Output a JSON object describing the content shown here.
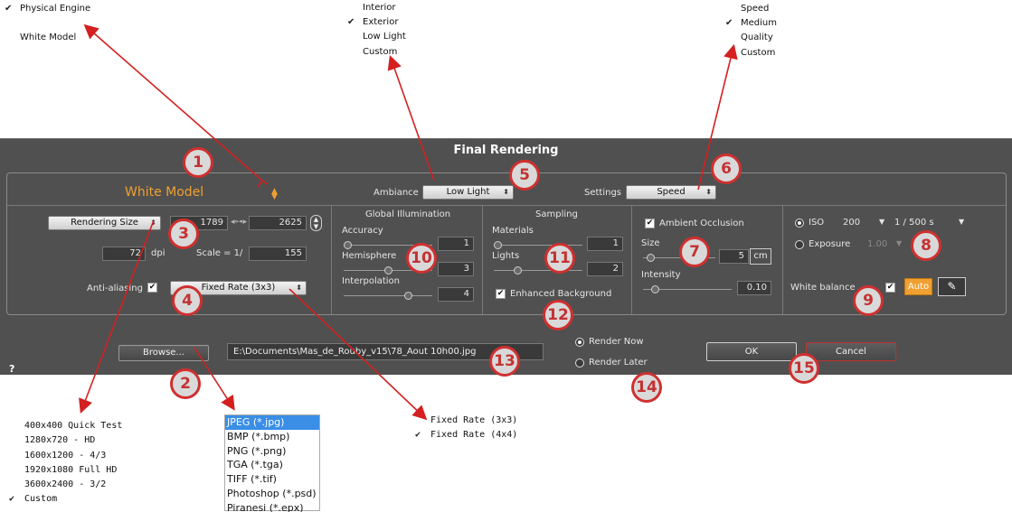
{
  "engine_menu": {
    "items": [
      {
        "label": "Physical Engine",
        "checked": true
      },
      {
        "label": "White Model",
        "checked": false
      }
    ]
  },
  "ambiance_menu": {
    "items": [
      {
        "label": "Interior",
        "checked": false
      },
      {
        "label": "Exterior",
        "checked": true
      },
      {
        "label": "Low Light",
        "checked": false
      },
      {
        "label": "Custom",
        "checked": false
      }
    ]
  },
  "settings_menu": {
    "items": [
      {
        "label": "Speed",
        "checked": false
      },
      {
        "label": "Medium",
        "checked": true
      },
      {
        "label": "Quality",
        "checked": false
      },
      {
        "label": "Custom",
        "checked": false
      }
    ]
  },
  "size_menu": {
    "items": [
      {
        "label": "400x400 Quick Test"
      },
      {
        "label": "1280x720 - HD"
      },
      {
        "label": "1600x1200 - 4/3"
      },
      {
        "label": "1920x1080 Full HD"
      },
      {
        "label": "3600x2400 - 3/2"
      },
      {
        "label": "Custom",
        "checked": true
      }
    ]
  },
  "format_menu": {
    "items": [
      {
        "label": "JPEG (*.jpg)",
        "selected": true
      },
      {
        "label": "BMP (*.bmp)"
      },
      {
        "label": "PNG (*.png)"
      },
      {
        "label": "TGA (*.tga)"
      },
      {
        "label": "TIFF (*.tif)"
      },
      {
        "label": "Photoshop (*.psd)"
      },
      {
        "label": "Piranesi (*.epx)"
      }
    ]
  },
  "aa_menu": {
    "items": [
      {
        "label": "Fixed Rate (3x3)",
        "checked": false
      },
      {
        "label": "Fixed Rate (4x4)",
        "checked": true
      }
    ]
  },
  "dialog": {
    "title": "Final Rendering",
    "engine_value": "White Model",
    "ambiance_label": "Ambiance",
    "ambiance_value": "Low Light",
    "settings_label": "Settings",
    "settings_value": "Speed",
    "rendering_size_value": "Rendering Size",
    "width": "1789",
    "height": "2625",
    "dpi_value": "72",
    "dpi_label": "dpi",
    "scale_label": "Scale = 1/",
    "scale_value": "155",
    "antialiasing_label": "Anti-aliasing",
    "antialiasing_value": "Fixed Rate (3x3)",
    "gi": {
      "title": "Global Illumination",
      "accuracy_label": "Accuracy",
      "accuracy_value": "1",
      "accuracy_level": 0,
      "hemisphere_label": "Hemisphere",
      "hemisphere_value": "3",
      "hemisphere_level": 0.5,
      "interpolation_label": "Interpolation",
      "interpolation_value": "4",
      "interpolation_level": 0.75
    },
    "sampling": {
      "title": "Sampling",
      "materials_label": "Materials",
      "materials_value": "1",
      "materials_level": 0,
      "lights_label": "Lights",
      "lights_value": "2",
      "lights_level": 0.25,
      "enhanced_label": "Enhanced Background"
    },
    "ao": {
      "label": "Ambient Occlusion",
      "size_label": "Size",
      "size_value": "5",
      "size_unit": "cm",
      "size_level": 0.05,
      "intensity_label": "Intensity",
      "intensity_value": "0.10",
      "intensity_level": 0.1
    },
    "camera": {
      "iso_label": "ISO",
      "iso_value": "200",
      "shutter_value": "1 / 500 s",
      "exposure_label": "Exposure",
      "exposure_value": "1.00",
      "white_balance_label": "White balance",
      "auto_label": "Auto"
    },
    "browse_label": "Browse...",
    "file_path": "E:\\Documents\\Mas_de_Rouby_v15\\78_Aout 10h00.jpg",
    "render_now_label": "Render Now",
    "render_later_label": "Render Later",
    "ok_label": "OK",
    "cancel_label": "Cancel",
    "help_label": "?"
  },
  "callouts": [
    "1",
    "2",
    "3",
    "4",
    "5",
    "6",
    "7",
    "8",
    "9",
    "10",
    "11",
    "12",
    "13",
    "14",
    "15"
  ],
  "colors": {
    "panel": "#505050",
    "accent_orange": "#f0a030",
    "callout_red": "#d03030",
    "arrow_red": "#d42020",
    "selection_blue": "#3a8ee6"
  },
  "icons": [
    "checkmark-icon",
    "updown-arrow-icon",
    "link-icon",
    "spinner-icon",
    "eyedropper-icon",
    "dropdown-arrow-icon",
    "radio-icon"
  ]
}
